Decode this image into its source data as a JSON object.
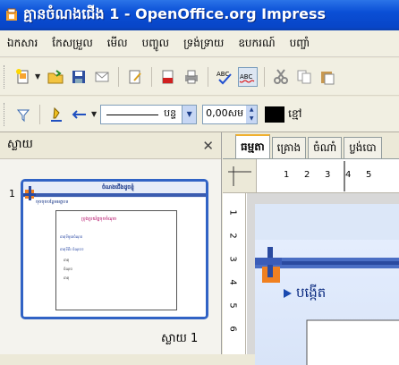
{
  "window": {
    "title": "គ្មានចំណងជើង 1 - OpenOffice.org Impress"
  },
  "menubar": {
    "items": [
      "ឯកសារ",
      "កែសម្រួល",
      "មើល",
      "បញ្ចូល",
      "ទ្រង់ទ្រាយ",
      "ឧបករណ៍",
      "បញ្ចាំ"
    ]
  },
  "toolbar2": {
    "line_style_label": "បន្ទ",
    "line_width_value": "0,00សម",
    "area_color_label": "ខ្មៅ"
  },
  "slides_pane": {
    "title": "ស្លាយ",
    "slide_number": "1",
    "slide_name": "ស្លាយ 1",
    "thumb": {
      "title": "ចំណងជើងដូចខ្ញុំ",
      "bullet": "ចុច​ចុច​បន្ថែម​អត្ថបទ",
      "inner_title": "ប្រុងប្រយ័ត្ន​ចុចចំណុច",
      "items": [
        "ធាតុ​ទី​មួយ​ចំណុច",
        "ធាតុ​ទី​ពីរ​ ចំណុច​ៗ",
        "ធាតុ",
        "ចំណុច",
        "ធាតុ"
      ]
    }
  },
  "workspace": {
    "tabs": [
      "ធម្មតា",
      "គ្រោង",
      "ចំណាំ",
      "ប្លង់បោ"
    ],
    "ruler_h": [
      "1",
      "2",
      "3",
      "4",
      "5"
    ],
    "ruler_v": [
      "1",
      "2",
      "3",
      "4",
      "5",
      "6"
    ],
    "slide_bullet": "បង្កើត"
  },
  "colors": {
    "title_bar": "#0a4fd6",
    "selection": "#3163c5",
    "accent_orange": "#f08020"
  }
}
